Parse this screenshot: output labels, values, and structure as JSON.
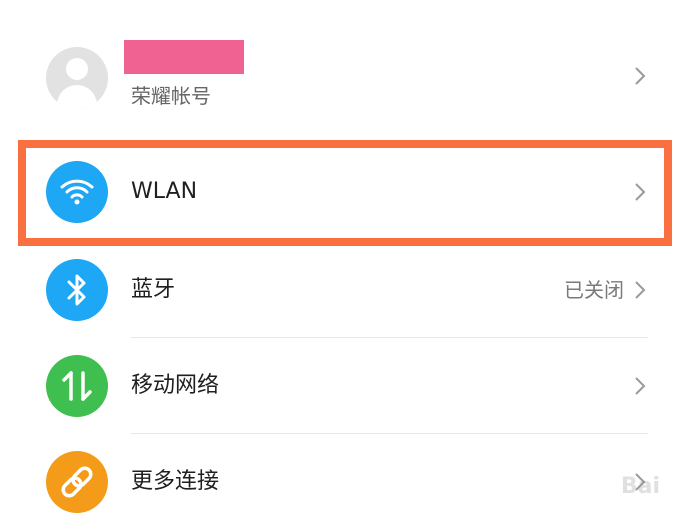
{
  "account": {
    "label": "荣耀帐号",
    "icon": "avatar-icon"
  },
  "rows": [
    {
      "label": "WLAN",
      "status": "",
      "icon": "wifi-icon",
      "color": "#1ea7f5"
    },
    {
      "label": "蓝牙",
      "status": "已关闭",
      "icon": "bluetooth-icon",
      "color": "#1ea7f5"
    },
    {
      "label": "移动网络",
      "status": "",
      "icon": "mobile-data-icon",
      "color": "#3fbf4f"
    },
    {
      "label": "更多连接",
      "status": "",
      "icon": "link-icon",
      "color": "#f59b1a"
    }
  ],
  "colors": {
    "highlight": "#fa7041",
    "redaction": "#f06292"
  },
  "watermark": {
    "text": "Bai"
  }
}
